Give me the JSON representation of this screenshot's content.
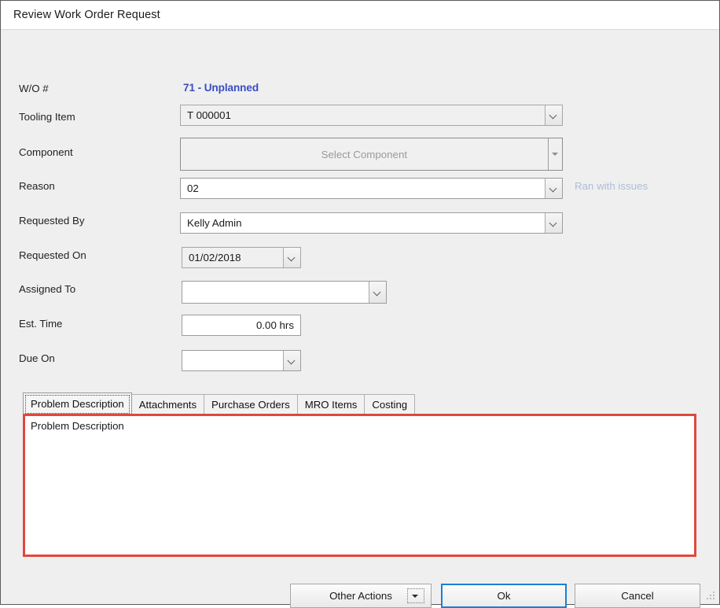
{
  "window": {
    "title": "Review Work Order Request"
  },
  "form": {
    "wo_number": {
      "label": "W/O #",
      "value": "71 - Unplanned",
      "color": "#3b4cc0"
    },
    "tooling_item": {
      "label": "Tooling Item",
      "value": "T 000001"
    },
    "component": {
      "label": "Component",
      "placeholder": "Select Component",
      "value": ""
    },
    "reason": {
      "label": "Reason",
      "value": "02",
      "note": "Ran with issues"
    },
    "requested_by": {
      "label": "Requested By",
      "value": "Kelly Admin"
    },
    "requested_on": {
      "label": "Requested On",
      "value": "01/02/2018"
    },
    "assigned_to": {
      "label": "Assigned To",
      "value": ""
    },
    "est_time": {
      "label": "Est. Time",
      "value": "0.00 hrs"
    },
    "due_on": {
      "label": "Due On",
      "value": ""
    }
  },
  "tabs": [
    {
      "label": "Problem Description",
      "active": true
    },
    {
      "label": "Attachments",
      "active": false
    },
    {
      "label": "Purchase Orders",
      "active": false
    },
    {
      "label": "MRO Items",
      "active": false
    },
    {
      "label": "Costing",
      "active": false
    }
  ],
  "panel": {
    "heading": "Problem Description",
    "border_color": "#e0483c",
    "body": ""
  },
  "footer": {
    "other_actions": "Other Actions",
    "ok": "Ok",
    "cancel": "Cancel"
  }
}
